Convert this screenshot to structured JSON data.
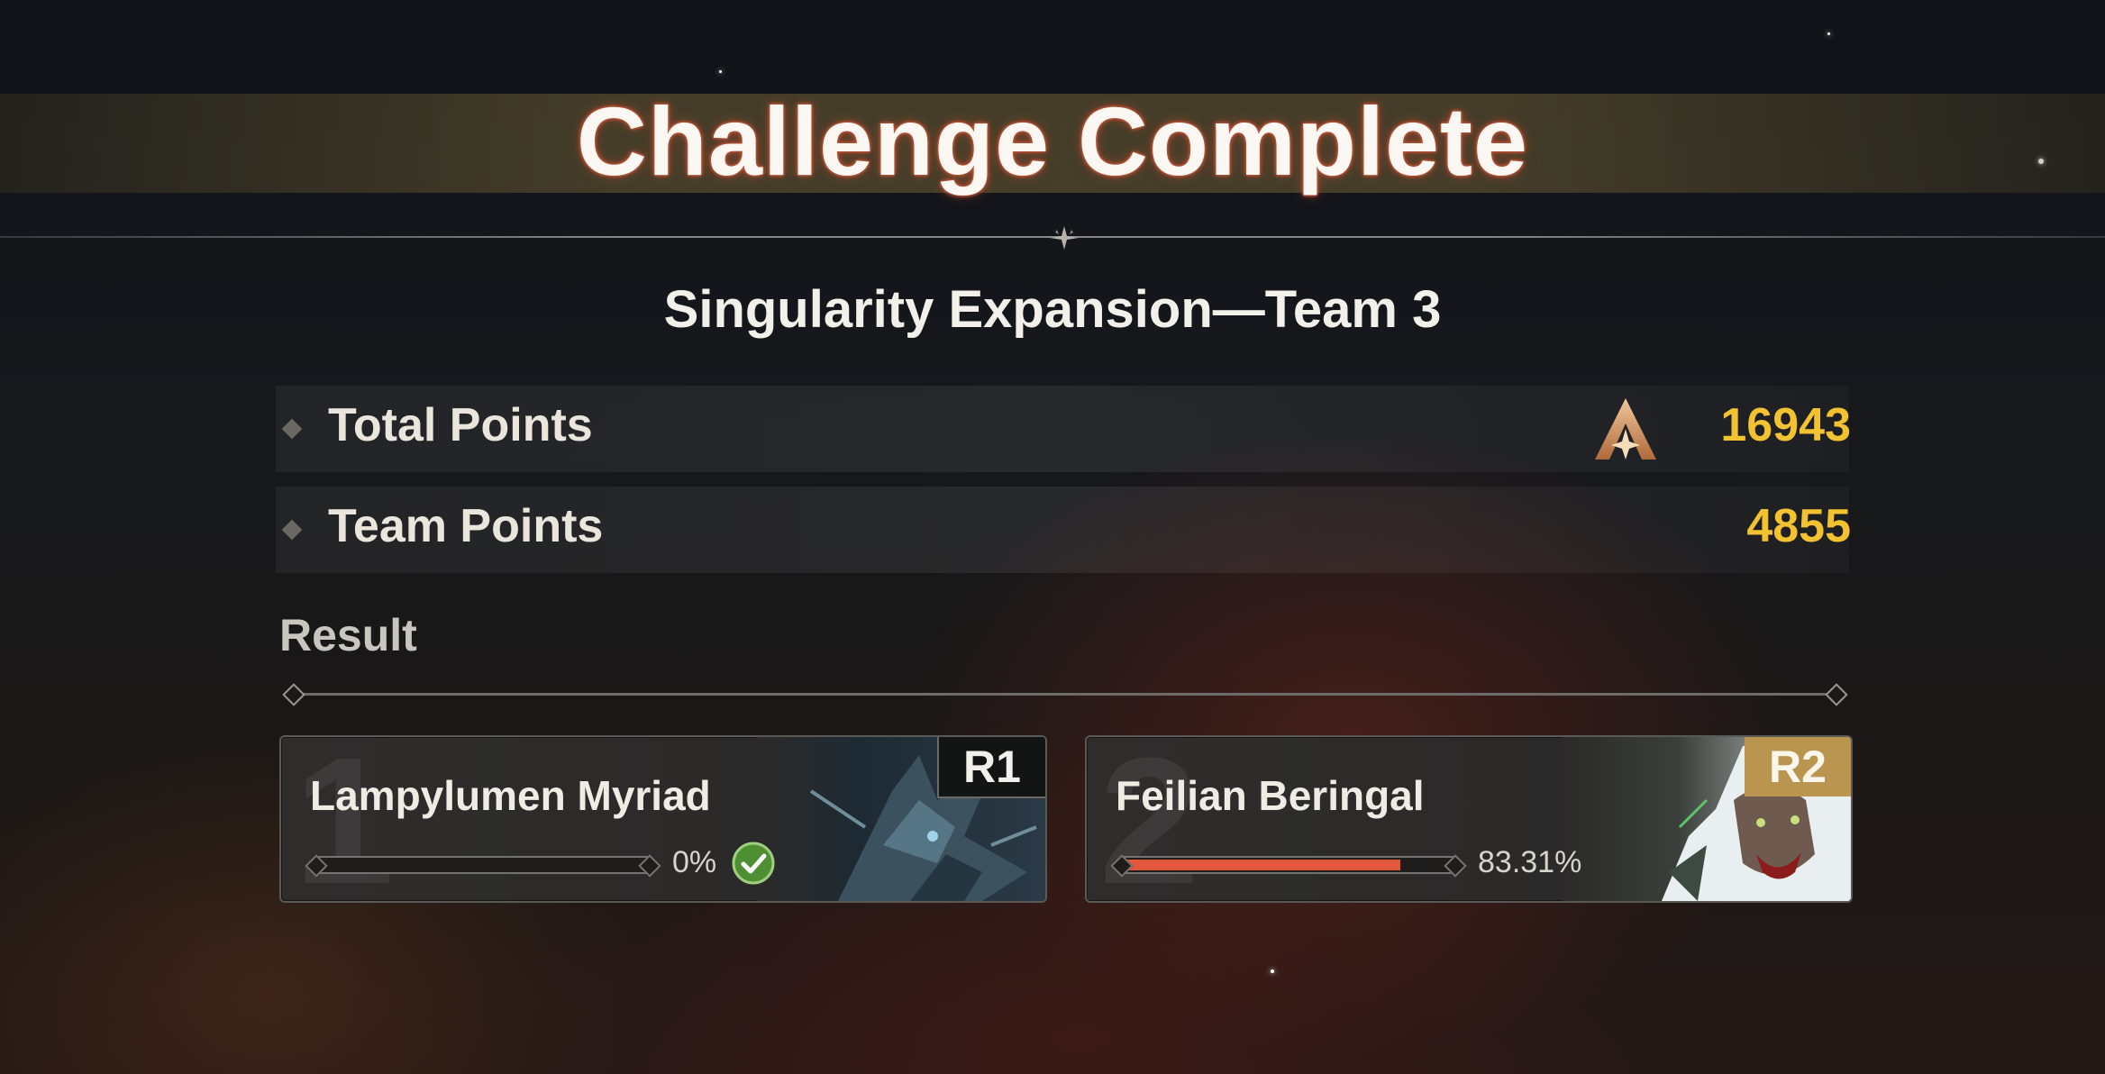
{
  "header": {
    "title": "Challenge Complete",
    "subtitle": "Singularity Expansion—Team 3"
  },
  "points": [
    {
      "label": "Total Points",
      "value": "16943",
      "icon": "rank-a-medal-icon"
    },
    {
      "label": "Team Points",
      "value": "4855"
    }
  ],
  "result": {
    "label": "Result",
    "cards": [
      {
        "index": "1",
        "name": "Lampylumen Myriad",
        "rank": "R1",
        "progress_percent": 0,
        "progress_text": "0%",
        "completed": true
      },
      {
        "index": "2",
        "name": "Feilian Beringal",
        "rank": "R2",
        "progress_percent": 83.31,
        "progress_text": "83.31%",
        "completed": false
      }
    ]
  },
  "colors": {
    "value_gold": "#f2c230",
    "progress_fill": "#e0573b",
    "rank_r2_bg": "#b9954f",
    "check_green": "#5aa33a"
  }
}
